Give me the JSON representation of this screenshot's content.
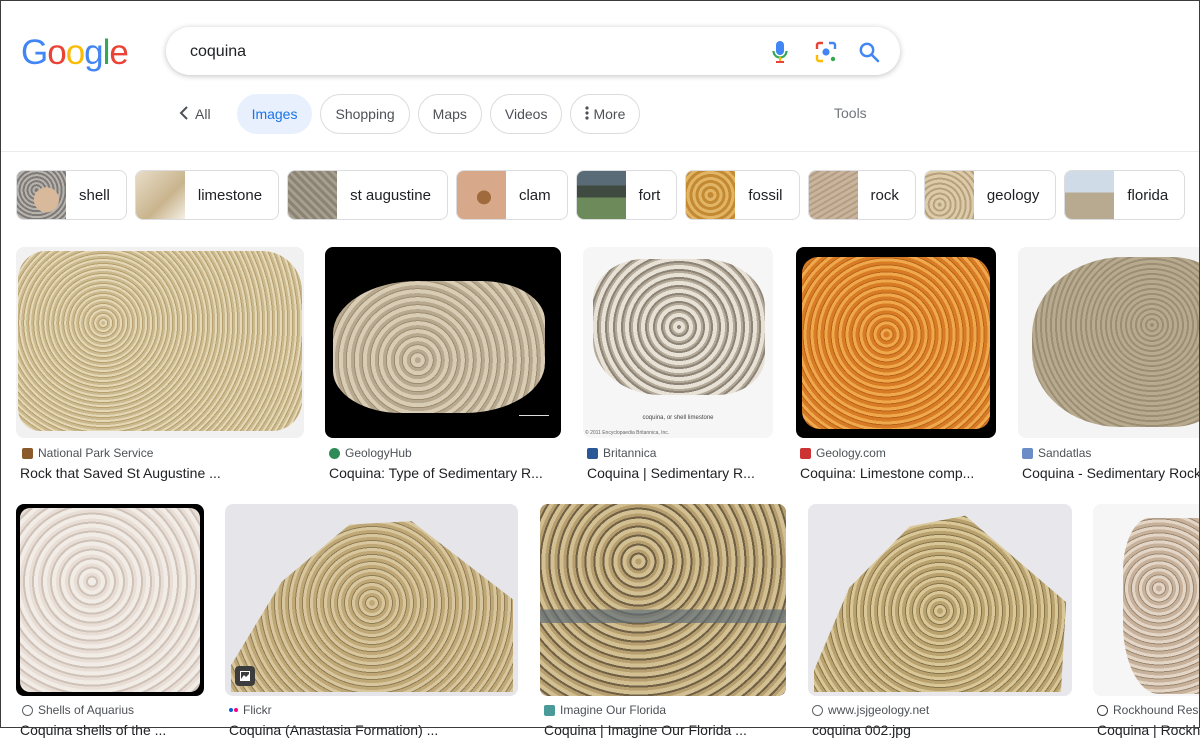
{
  "logo": {
    "letters": [
      "G",
      "o",
      "o",
      "g",
      "l",
      "e"
    ],
    "colors": [
      "#4285f4",
      "#ea4335",
      "#fbbc05",
      "#4285f4",
      "#34a853",
      "#ea4335"
    ]
  },
  "search": {
    "query": "coquina"
  },
  "tabs": {
    "all": "All",
    "images": "Images",
    "shopping": "Shopping",
    "maps": "Maps",
    "videos": "Videos",
    "more": "More",
    "tools": "Tools"
  },
  "related": [
    {
      "label": "shell"
    },
    {
      "label": "limestone"
    },
    {
      "label": "st augustine"
    },
    {
      "label": "clam"
    },
    {
      "label": "fort"
    },
    {
      "label": "fossil"
    },
    {
      "label": "rock"
    },
    {
      "label": "geology"
    },
    {
      "label": "florida"
    }
  ],
  "results": [
    {
      "source": "National Park Service",
      "title": "Rock that Saved St Augustine ..."
    },
    {
      "source": "GeologyHub",
      "title": "Coquina: Type of Sedimentary R..."
    },
    {
      "source": "Britannica",
      "title": "Coquina | Sedimentary R..."
    },
    {
      "source": "Geology.com",
      "title": "Coquina: Limestone comp..."
    },
    {
      "source": "Sandatlas",
      "title": "Coquina - Sedimentary Rock"
    },
    {
      "source": "Shells of Aquarius",
      "title": "Coquina shells of the ..."
    },
    {
      "source": "Flickr",
      "title": "Coquina (Anastasia Formation) ..."
    },
    {
      "source": "Imagine Our Florida",
      "title": "Coquina | Imagine Our Florida ..."
    },
    {
      "source": "www.jsjgeology.net",
      "title": "coquina 002.jpg"
    },
    {
      "source": "Rockhound Resource",
      "title": "Coquina | Rockhound ..."
    }
  ],
  "image_caption": "coquina, or shell limestone",
  "image_copyright": "© 2011 Encyclopaedia Britannica, Inc.",
  "colors": {
    "accent": "#1a73e8",
    "active_tab_bg": "#e8f0fe",
    "chip_border": "#dadce0"
  }
}
